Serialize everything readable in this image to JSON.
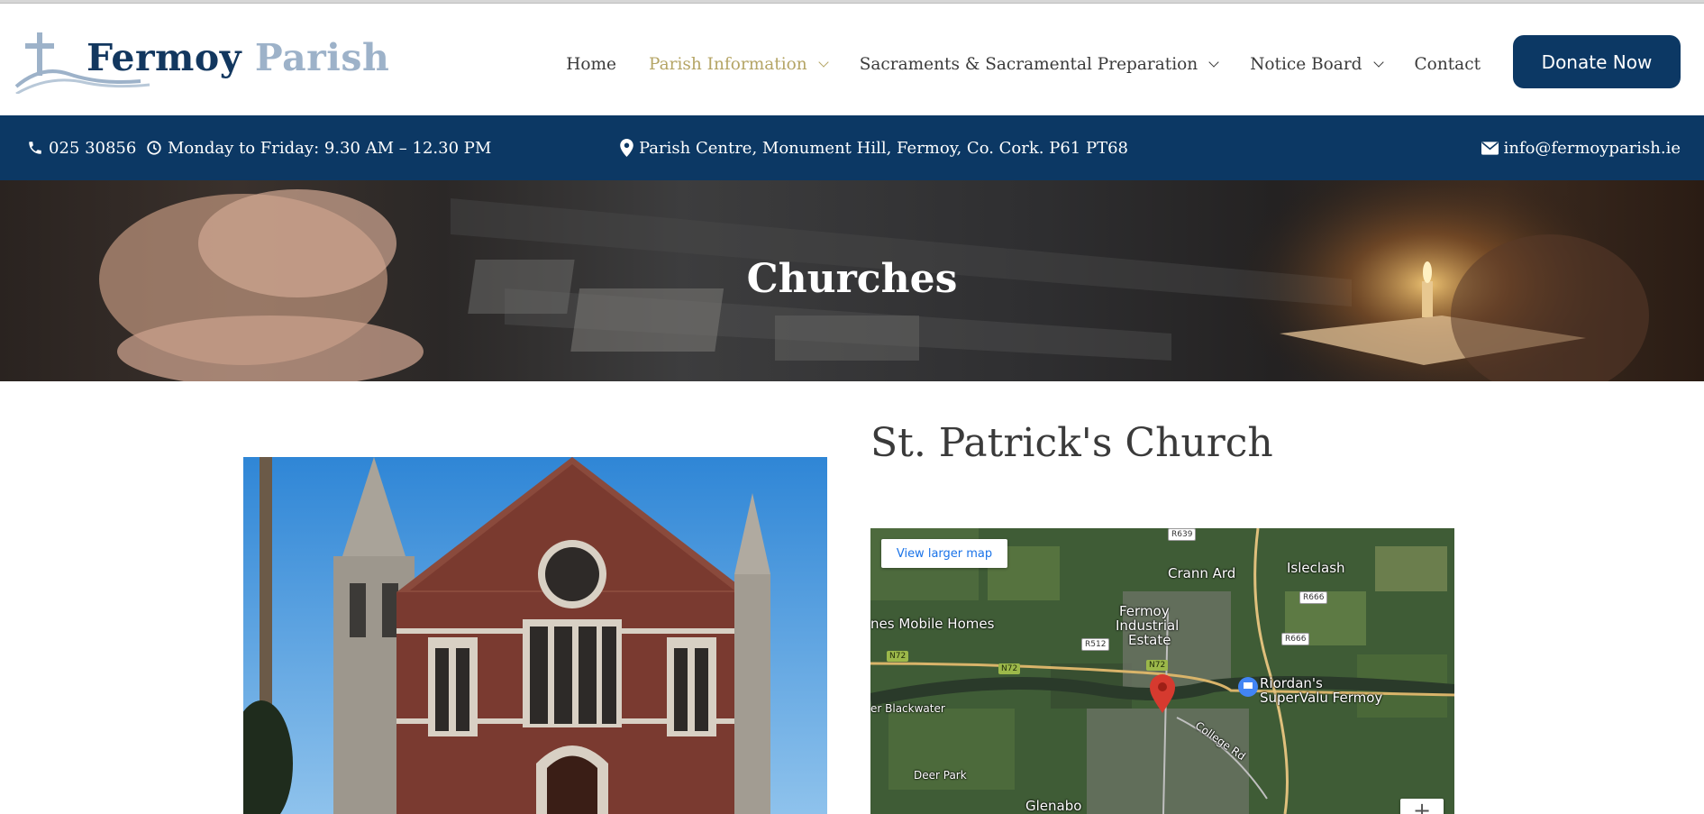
{
  "site": {
    "logo_word1": "Fermoy",
    "logo_word2": "Parish"
  },
  "nav": {
    "items": [
      {
        "label": "Home",
        "has_dropdown": false,
        "active": false
      },
      {
        "label": "Parish Information",
        "has_dropdown": true,
        "active": true
      },
      {
        "label": "Sacraments & Sacramental Preparation",
        "has_dropdown": true,
        "active": false
      },
      {
        "label": "Notice Board",
        "has_dropdown": true,
        "active": false
      },
      {
        "label": "Contact",
        "has_dropdown": false,
        "active": false
      }
    ],
    "donate_label": "Donate Now"
  },
  "infobar": {
    "phone": "025 30856",
    "hours": "Monday to Friday: 9.30 AM – 12.30 PM",
    "address": "Parish Centre, Monument Hill, Fermoy, Co. Cork. P61 PT68",
    "email": "info@fermoyparish.ie"
  },
  "hero": {
    "title": "Churches"
  },
  "church": {
    "title": "St. Patrick's Church"
  },
  "map": {
    "view_larger": "View larger map",
    "zoom_in": "+",
    "labels": {
      "crann_ard": "Crann Ard",
      "isleclash": "Isleclash",
      "fermoy_ind_1": "Fermoy",
      "fermoy_ind_2": "Industrial",
      "fermoy_ind_3": "Estate",
      "mobile_homes": "nes Mobile Homes",
      "blackwater": "er Blackwater",
      "riordans_1": "Riordan's",
      "riordans_2": "SuperValu Fermoy",
      "college_rd": "College Rd",
      "deer_park": "Deer Park",
      "glenabo": "Glenabo"
    },
    "roads": {
      "r639": "R639",
      "r666a": "R666",
      "r666b": "R666",
      "r512": "R512",
      "n72a": "N72",
      "n72b": "N72",
      "n72c": "N72"
    }
  },
  "colors": {
    "brand_navy": "#0c3864",
    "nav_active": "#b5a566",
    "logo_light": "#9db2c9"
  }
}
